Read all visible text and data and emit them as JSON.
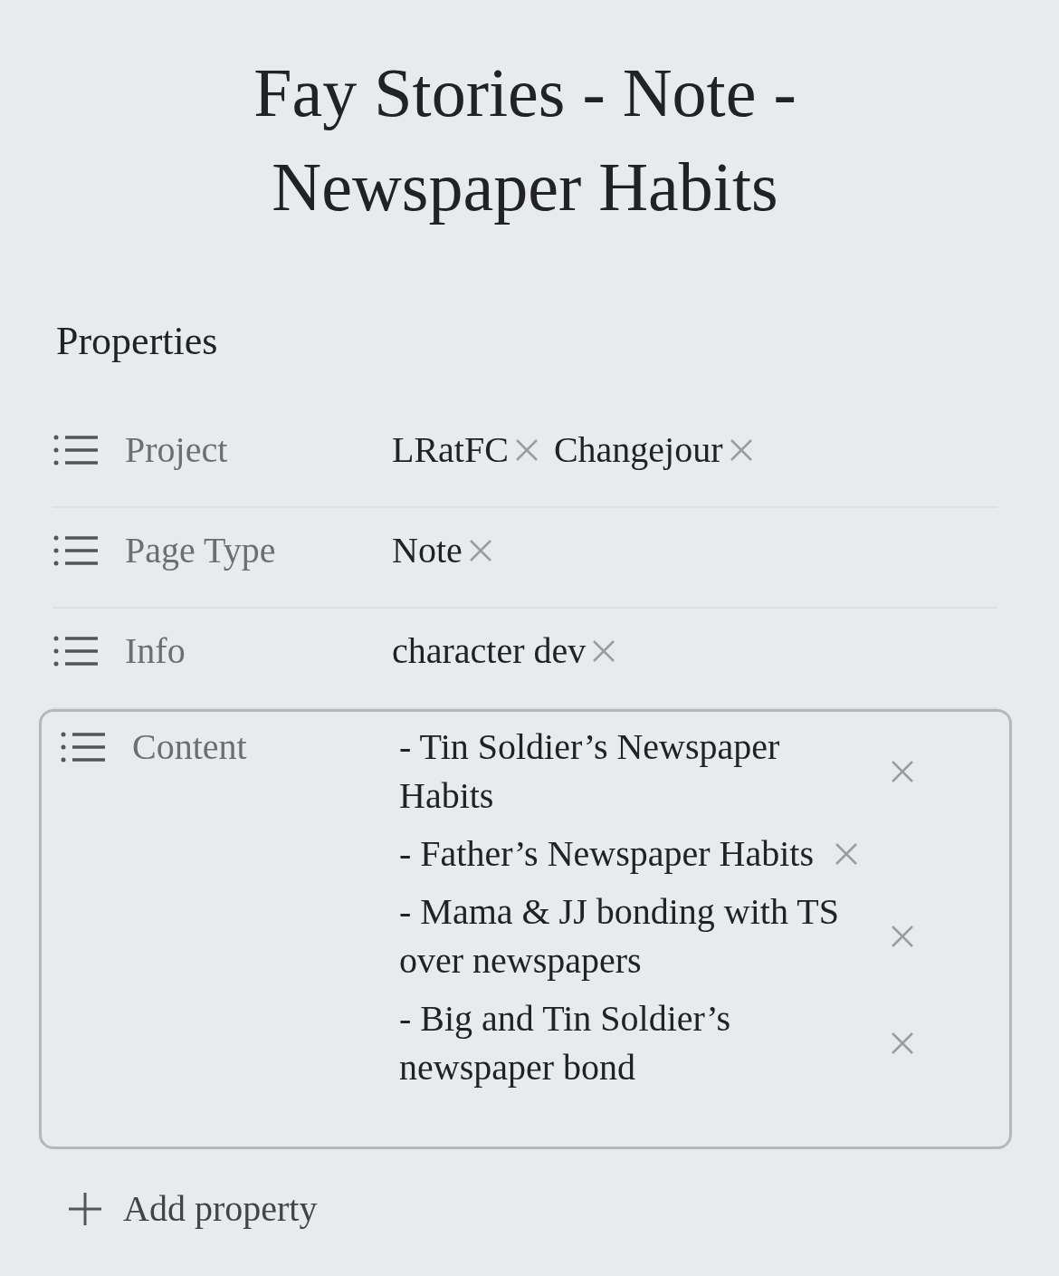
{
  "title": "Fay Stories - Note - Newspaper Habits",
  "properties_heading": "Properties",
  "properties": [
    {
      "label": "Project",
      "kind": "tags",
      "focused": false,
      "values": [
        "LRatFC",
        "Changejour"
      ]
    },
    {
      "label": "Page Type",
      "kind": "tags",
      "focused": false,
      "values": [
        "Note"
      ]
    },
    {
      "label": "Info",
      "kind": "tags",
      "focused": false,
      "values": [
        "character dev"
      ]
    },
    {
      "label": "Content",
      "kind": "lines",
      "focused": true,
      "values": [
        "- Tin Soldier’s Newspaper Habits",
        "- Father’s Newspaper Habits",
        "- Mama & JJ bonding with TS over newspapers",
        "- Big and Tin Soldier’s newspaper bond"
      ]
    }
  ],
  "add_property": "Add property"
}
